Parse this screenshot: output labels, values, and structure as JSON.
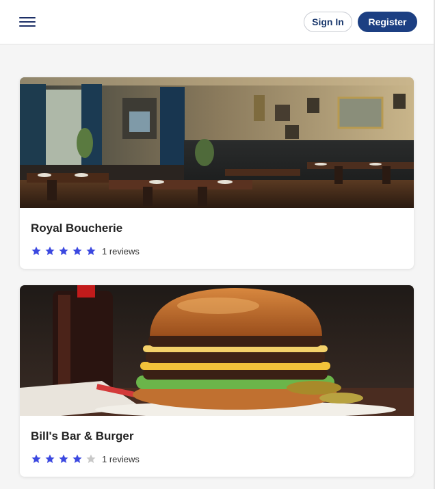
{
  "header": {
    "menu_icon": "hamburger-menu-icon",
    "sign_in_label": "Sign In",
    "register_label": "Register"
  },
  "colors": {
    "brand": "#1c3f82",
    "star_filled": "#3b48e0",
    "star_empty": "#c8c8c8"
  },
  "restaurants": [
    {
      "name": "Royal Boucherie",
      "rating": 5,
      "max_rating": 5,
      "reviews_text": "1 reviews"
    },
    {
      "name": "Bill's Bar & Burger",
      "rating": 4,
      "max_rating": 5,
      "reviews_text": "1 reviews"
    }
  ]
}
